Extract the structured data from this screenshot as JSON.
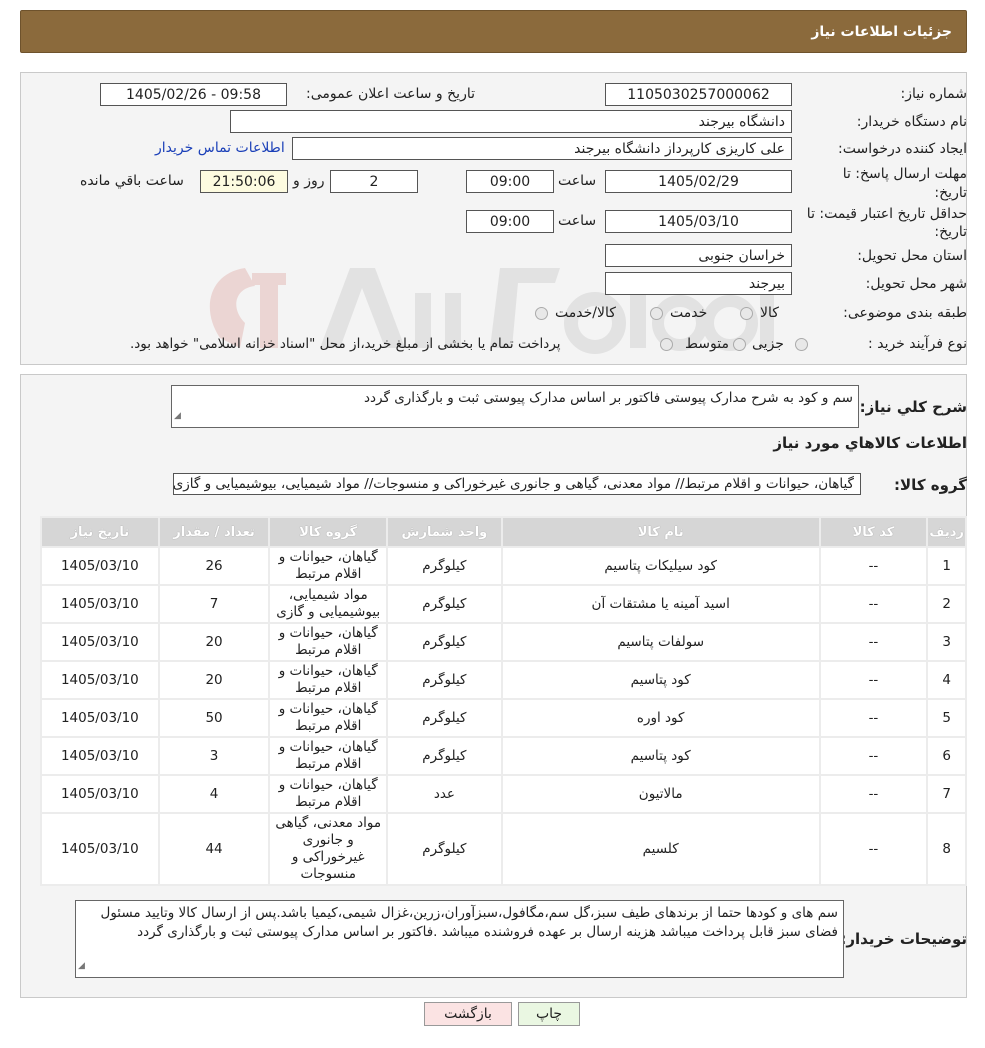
{
  "header": {
    "title": "جزئیات اطلاعات نیاز"
  },
  "info": {
    "need_number_label": "شماره نیاز:",
    "need_number": "1105030257000062",
    "announce_label": "تاریخ و ساعت اعلان عمومی:",
    "announce_value": "1405/02/26 - 09:58",
    "buyer_org_label": "نام دستگاه خریدار:",
    "buyer_org": "دانشگاه بیرجند",
    "creator_label": "ایجاد کننده درخواست:",
    "creator": "علی کاریزی کارپرداز دانشگاه بیرجند",
    "contact_link": "اطلاعات تماس خریدار",
    "reply_deadline_label_1": "مهلت ارسال پاسخ: تا",
    "reply_deadline_label_2": "تاریخ:",
    "reply_date": "1405/02/29",
    "time_label": "ساعت",
    "reply_time": "09:00",
    "days_value": "2",
    "days_label": "روز و",
    "remaining_time": "21:50:06",
    "remaining_label": "ساعت باقي مانده",
    "price_valid_label_1": "حداقل تاریخ اعتبار قیمت: تا",
    "price_valid_label_2": "تاریخ:",
    "price_valid_date": "1405/03/10",
    "price_valid_time": "09:00",
    "province_label": "استان محل تحویل:",
    "province": "خراسان جنوبی",
    "city_label": "شهر محل تحویل:",
    "city": "بیرجند",
    "category_label": "طبقه بندی موضوعی:",
    "category_options": [
      "کالا",
      "خدمت",
      "کالا/خدمت"
    ],
    "process_label": "نوع فرآیند خرید :",
    "process_options": [
      "جزیی",
      "متوسط"
    ],
    "process_note": "پرداخت تمام یا بخشی از مبلغ خرید،از محل \"اسناد خزانه اسلامی\" خواهد بود."
  },
  "details": {
    "summary_label": "شرح کلي نياز:",
    "summary": "سم و کود به شرح مدارک پیوستی فاکتور بر اساس مدارک پیوستی ثبت و بارگذاری گردد",
    "items_title": "اطلاعات کالاهاي مورد نياز",
    "group_label": "گروه کالا:",
    "group_value": "گیاهان، حیوانات و اقلام مرتبط// مواد معدنی، گیاهی و جانوری غیرخوراکی و منسوجات// مواد شیمیایی، بیوشیمیایی و گازی",
    "table": {
      "headers": [
        "ردیف",
        "کد کالا",
        "نام کالا",
        "واحد شمارش",
        "گروه کالا",
        "تعداد / مقدار",
        "تاریخ نیاز"
      ],
      "rows": [
        [
          "1",
          "--",
          "کود سیلیکات پتاسیم",
          "کیلوگرم",
          "گیاهان، حیوانات و اقلام مرتبط",
          "26",
          "1405/03/10"
        ],
        [
          "2",
          "--",
          "اسید آمینه یا مشتقات آن",
          "کیلوگرم",
          "مواد شیمیایی، بیوشیمیایی و گازی",
          "7",
          "1405/03/10"
        ],
        [
          "3",
          "--",
          "سولفات پتاسیم",
          "کیلوگرم",
          "گیاهان، حیوانات و اقلام مرتبط",
          "20",
          "1405/03/10"
        ],
        [
          "4",
          "--",
          "کود پتاسیم",
          "کیلوگرم",
          "گیاهان، حیوانات و اقلام مرتبط",
          "20",
          "1405/03/10"
        ],
        [
          "5",
          "--",
          "کود اوره",
          "کیلوگرم",
          "گیاهان، حیوانات و اقلام مرتبط",
          "50",
          "1405/03/10"
        ],
        [
          "6",
          "--",
          "کود پتاسیم",
          "کیلوگرم",
          "گیاهان، حیوانات و اقلام مرتبط",
          "3",
          "1405/03/10"
        ],
        [
          "7",
          "--",
          "مالاتیون",
          "عدد",
          "گیاهان، حیوانات و اقلام مرتبط",
          "4",
          "1405/03/10"
        ],
        [
          "8",
          "--",
          "کلسیم",
          "کیلوگرم",
          "مواد معدنی، گیاهی و جانوری غیرخوراکی و منسوجات",
          "44",
          "1405/03/10"
        ]
      ]
    },
    "buyer_notes_label": "توضیحات خریدار:",
    "buyer_notes": "سم های و کودها حتما از برندهای طیف سبز،گل سم،مگافول،سبزآوران،زرین،غزال شیمی،کیمیا باشد.پس از ارسال کالا وتایید مسئول فضای سبز قابل پرداخت میباشد هزینه ارسال بر عهده فروشنده میباشد .فاکتور بر اساس مدارک پیوستی ثبت و بارگذاری گردد"
  },
  "buttons": {
    "print": "چاپ",
    "back": "بازگشت"
  },
  "colors": {
    "header_bg": "#8b6a3c",
    "link": "#1a3fb8",
    "print_btn": "#eaf7e2",
    "back_btn": "#fbe3e3"
  }
}
